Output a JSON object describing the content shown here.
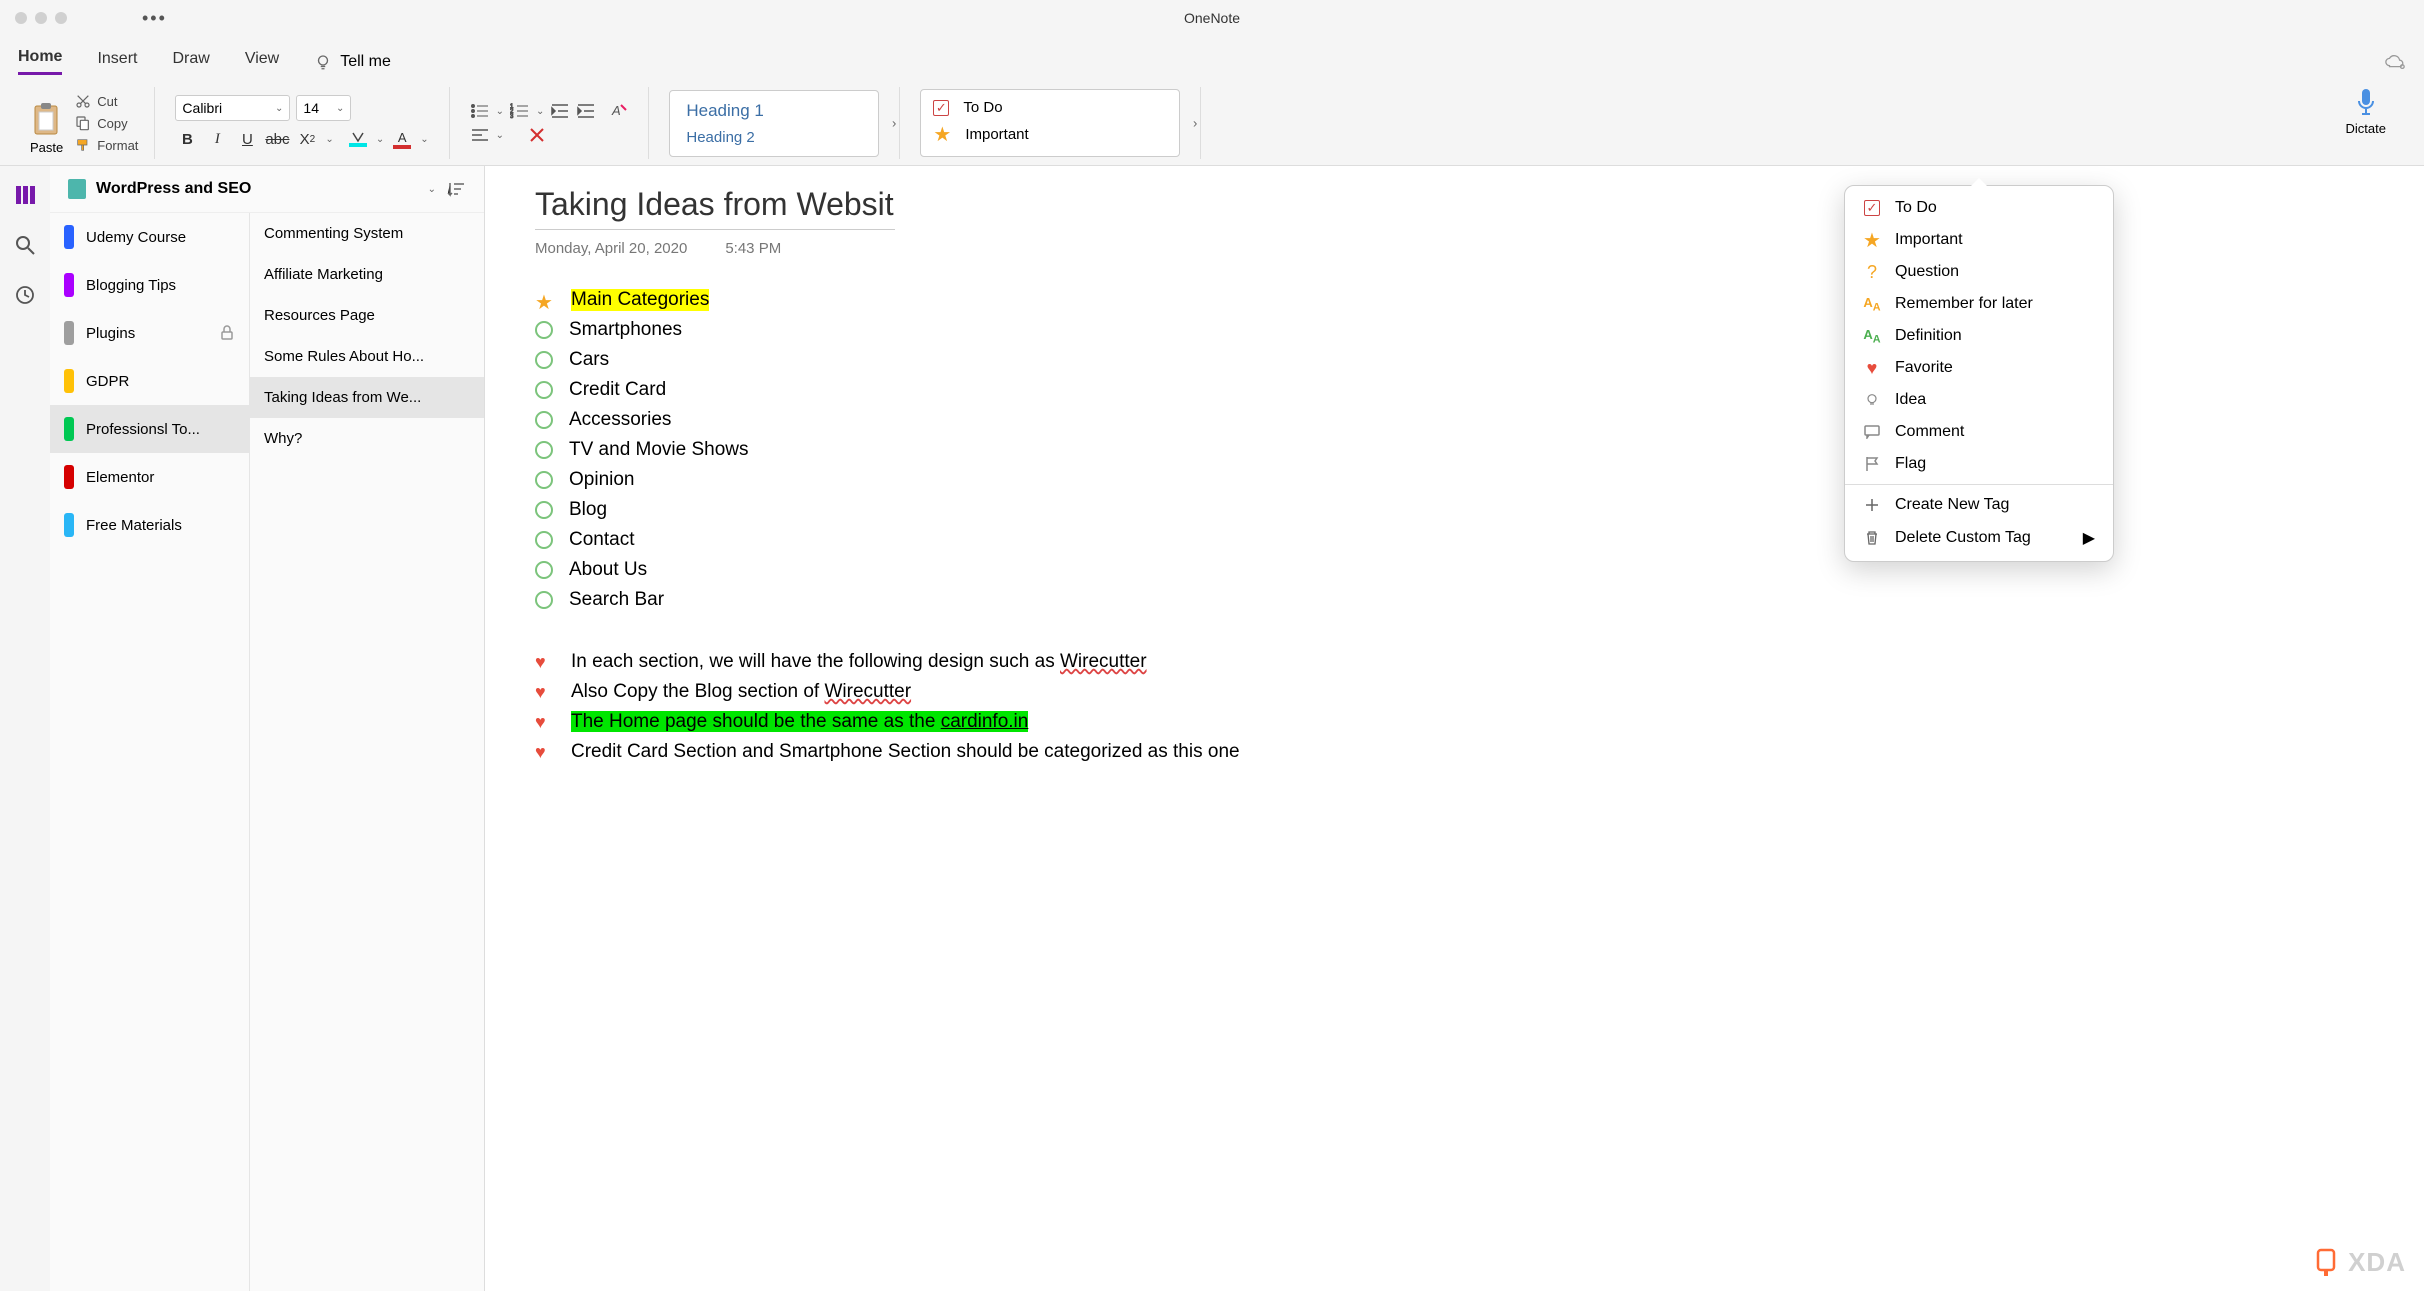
{
  "app": {
    "title": "OneNote"
  },
  "tabs": {
    "home": "Home",
    "insert": "Insert",
    "draw": "Draw",
    "view": "View",
    "tellme": "Tell me"
  },
  "clipboard": {
    "paste": "Paste",
    "cut": "Cut",
    "copy": "Copy",
    "format": "Format"
  },
  "font": {
    "name": "Calibri",
    "size": "14"
  },
  "headings": {
    "h1": "Heading 1",
    "h2": "Heading 2"
  },
  "tagbar": {
    "todo": "To Do",
    "important": "Important"
  },
  "dictate": "Dictate",
  "notebook": {
    "title": "WordPress and SEO"
  },
  "sections": [
    {
      "label": "Udemy Course",
      "color": "#2962ff"
    },
    {
      "label": "Blogging Tips",
      "color": "#aa00ff"
    },
    {
      "label": "Plugins",
      "color": "#9e9e9e",
      "locked": true
    },
    {
      "label": "GDPR",
      "color": "#ffc107"
    },
    {
      "label": "Professionsl To...",
      "color": "#00c853",
      "active": true
    },
    {
      "label": "Elementor",
      "color": "#d50000"
    },
    {
      "label": "Free Materials",
      "color": "#29b6f6"
    }
  ],
  "pages": [
    {
      "label": "Commenting System"
    },
    {
      "label": "Affiliate Marketing"
    },
    {
      "label": "Resources Page"
    },
    {
      "label": "Some Rules About Ho..."
    },
    {
      "label": "Taking Ideas from We...",
      "active": true
    },
    {
      "label": "Why?"
    }
  ],
  "note": {
    "title": "Taking Ideas from Websit",
    "date": "Monday, April 20, 2020",
    "time": "5:43 PM",
    "categories_heading": "Main Categories",
    "categories": [
      "Smartphones",
      "Cars",
      "Credit Card",
      "Accessories",
      "TV and Movie Shows",
      "Opinion",
      "Blog",
      "Contact",
      "About Us",
      "Search Bar"
    ],
    "favorites": [
      {
        "pre": "In each section, we will have the following design such as ",
        "wavy": "Wirecutter"
      },
      {
        "pre": "Also Copy the Blog section of ",
        "wavy": "Wirecutter"
      },
      {
        "pre_hl": "The Home page should be the same as the ",
        "link": "cardinfo.in"
      },
      {
        "pre": "Credit Card Section and Smartphone Section should be categorized as this one"
      }
    ]
  },
  "tag_menu": {
    "items": [
      {
        "icon": "checkbox",
        "label": "To Do"
      },
      {
        "icon": "star",
        "label": "Important"
      },
      {
        "icon": "question",
        "label": "Question"
      },
      {
        "icon": "aa-yellow",
        "label": "Remember for later"
      },
      {
        "icon": "aa-green",
        "label": "Definition"
      },
      {
        "icon": "heart",
        "label": "Favorite"
      },
      {
        "icon": "bulb",
        "label": "Idea"
      },
      {
        "icon": "comment",
        "label": "Comment"
      },
      {
        "icon": "flag",
        "label": "Flag"
      }
    ],
    "create": "Create New Tag",
    "delete": "Delete Custom Tag"
  },
  "watermark": "XDA"
}
